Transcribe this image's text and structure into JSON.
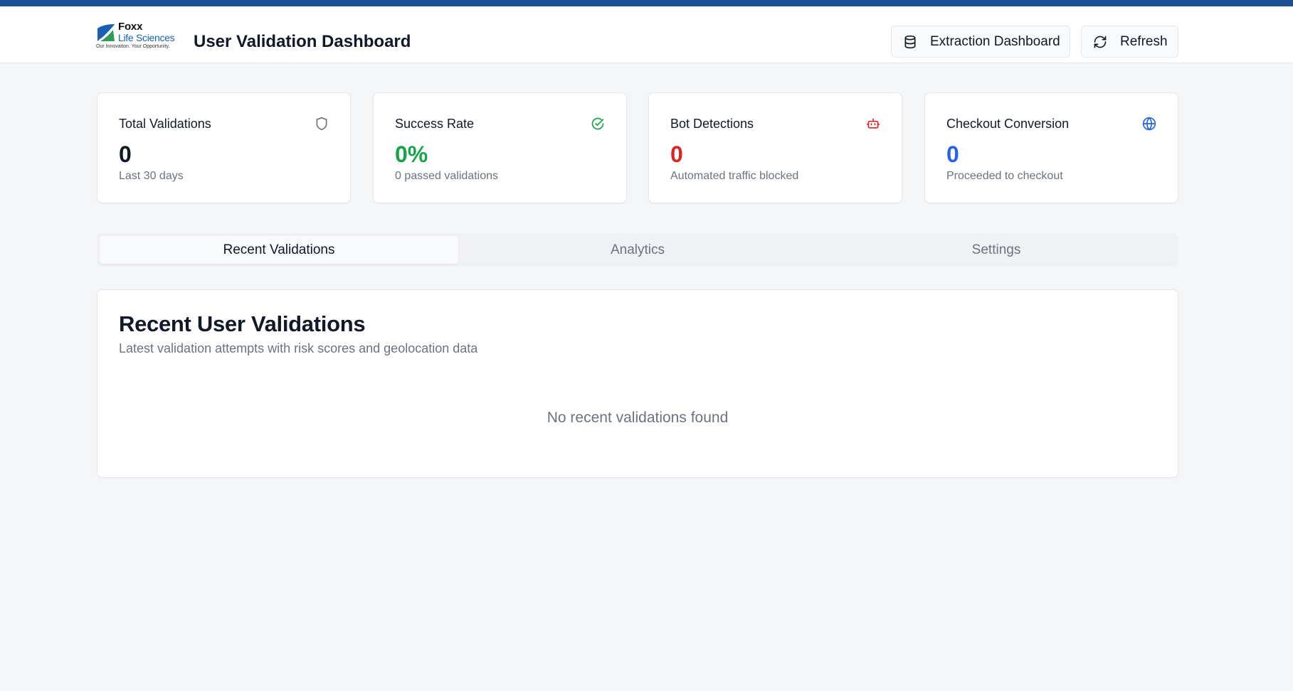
{
  "brand": {
    "name": "Foxx",
    "sub": "Life Sciences",
    "tagline": "Our Innovation. Your Opportunity."
  },
  "header": {
    "title": "User Validation Dashboard",
    "extraction_label": "Extraction Dashboard",
    "refresh_label": "Refresh"
  },
  "stats": [
    {
      "title": "Total Validations",
      "value": "0",
      "subtitle": "Last 30 days",
      "icon": "shield-icon",
      "color": "#111827"
    },
    {
      "title": "Success Rate",
      "value": "0%",
      "subtitle": "0 passed validations",
      "icon": "check-circle-icon",
      "color": "#16a34a"
    },
    {
      "title": "Bot Detections",
      "value": "0",
      "subtitle": "Automated traffic blocked",
      "icon": "bot-icon",
      "color": "#dc2626"
    },
    {
      "title": "Checkout Conversion",
      "value": "0",
      "subtitle": "Proceeded to checkout",
      "icon": "globe-icon",
      "color": "#2563eb"
    }
  ],
  "tabs": [
    {
      "label": "Recent Validations",
      "active": true
    },
    {
      "label": "Analytics",
      "active": false
    },
    {
      "label": "Settings",
      "active": false
    }
  ],
  "panel": {
    "title": "Recent User Validations",
    "subtitle": "Latest validation attempts with risk scores and geolocation data",
    "empty_message": "No recent validations found"
  },
  "colors": {
    "top_strip": "#1c4f94",
    "background": "#f5f6f8"
  }
}
